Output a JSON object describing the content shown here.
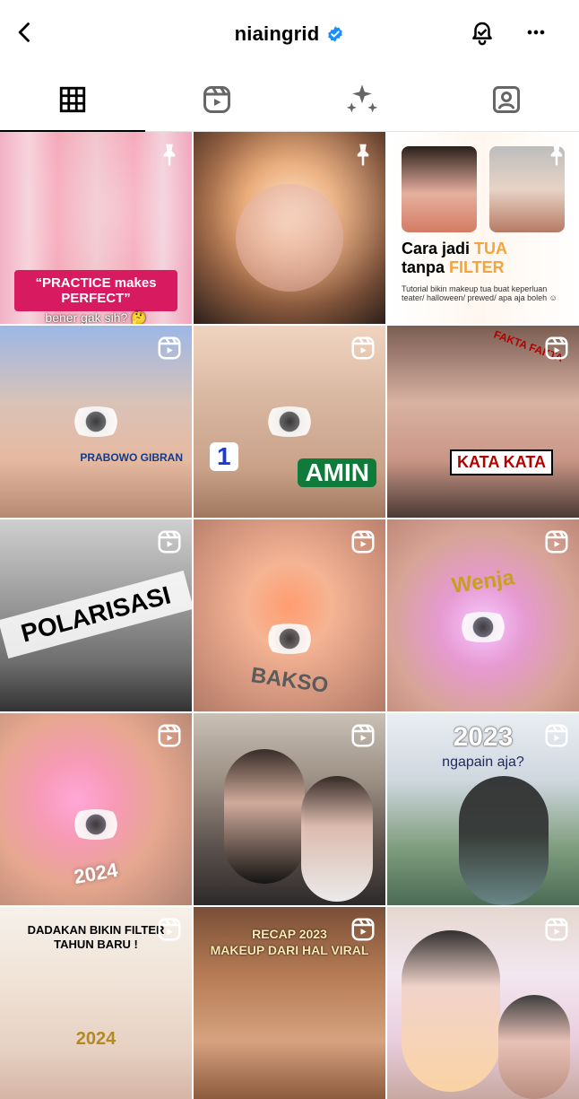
{
  "header": {
    "username": "niaingrid"
  },
  "tabs": [
    {
      "name": "posts"
    },
    {
      "name": "reels"
    },
    {
      "name": "highlights"
    },
    {
      "name": "tagged"
    }
  ],
  "posts": [
    {
      "id": "tile-1",
      "caption_pill": "“PRACTICE makes PERFECT”",
      "caption_sub": "bener gak sih? 🤔"
    },
    {
      "id": "tile-2"
    },
    {
      "id": "tile-3",
      "title_line1": "Cara jadi ",
      "title_line1_hl": "TUA",
      "title_line2": "tanpa ",
      "title_line2_hl": "FILTER",
      "desc": "Tutorial bikin makeup tua buat keperluan teater/ halloween/ prewed/ apa aja boleh ☺"
    },
    {
      "id": "tile-4",
      "chips": [
        "PRABOWO GIBRAN"
      ]
    },
    {
      "id": "tile-5",
      "chips": [
        "1",
        "AMIN"
      ]
    },
    {
      "id": "tile-6",
      "chips": [
        "FAKTA FAKTA",
        "KATA KATA"
      ]
    },
    {
      "id": "tile-7",
      "big": "POLARISASI"
    },
    {
      "id": "tile-8",
      "big": "BAKSO"
    },
    {
      "id": "tile-9",
      "big": "Wenja"
    },
    {
      "id": "tile-10",
      "big": "2024"
    },
    {
      "id": "tile-11"
    },
    {
      "id": "tile-12",
      "big": "2023",
      "sub": "ngapain aja?"
    },
    {
      "id": "tile-13",
      "big": "DADAKAN BIKIN FILTER TAHUN BARU !",
      "sub": "2024"
    },
    {
      "id": "tile-14",
      "big": "RECAP 2023",
      "sub": "MAKEUP DARI HAL VIRAL"
    },
    {
      "id": "tile-15"
    }
  ]
}
